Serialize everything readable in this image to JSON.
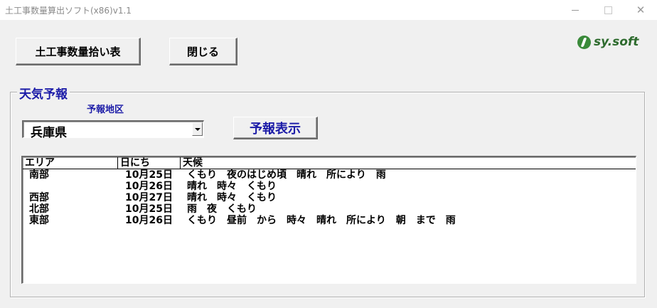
{
  "window": {
    "title": "土工事数量算出ソフト(x86)v1.1"
  },
  "toolbar": {
    "list_button_label": "土工事数量拾い表",
    "close_button_label": "閉じる"
  },
  "logo": {
    "text": "sy.soft",
    "accent_color": "#2e6b2e"
  },
  "weather": {
    "group_title": "天気予報",
    "region_label": "予報地区",
    "region_value": "兵庫県",
    "forecast_button_label": "予報表示",
    "accent_color": "#1c1ca8",
    "columns": [
      "エリア",
      "日にち",
      "天候"
    ],
    "rows": [
      {
        "area": "南部",
        "date": "10月25日",
        "weather": "くもり　夜のはじめ頃　晴れ　所により　雨"
      },
      {
        "area": "",
        "date": "10月26日",
        "weather": "晴れ　時々　くもり"
      },
      {
        "area": "西部",
        "date": "10月27日",
        "weather": "晴れ　時々　くもり"
      },
      {
        "area": "北部",
        "date": "10月25日",
        "weather": "雨　夜　くもり"
      },
      {
        "area": "東部",
        "date": "10月26日",
        "weather": "くもり　昼前　から　時々　晴れ　所により　朝　まで　雨"
      }
    ]
  }
}
